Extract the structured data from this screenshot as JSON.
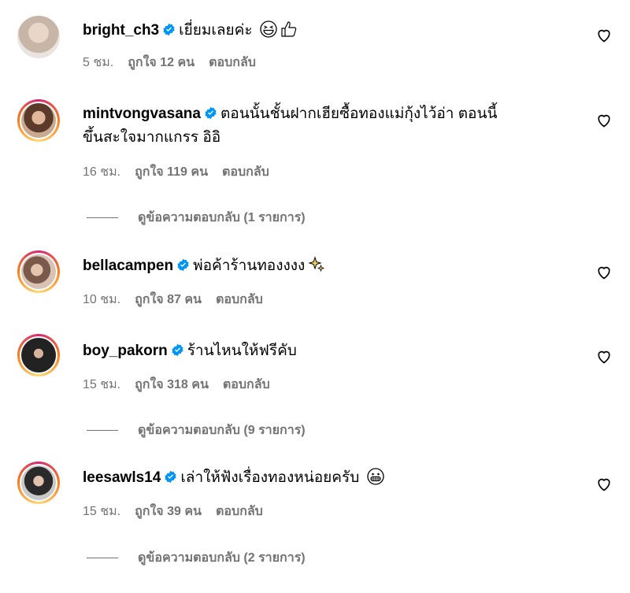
{
  "comments": [
    {
      "username": "bright_ch3",
      "text": "เยี่ยมเลยค่ะ",
      "time": "5 ชม.",
      "likes": "ถูกใจ 12 คน",
      "reply": "ตอบกลับ",
      "story_ring": false
    },
    {
      "username": "mintvongvasana",
      "text": "ตอนนั้นชั้นฝากเฮียซื้อทองแม่กุ้งไว้อ่า ตอนนี้",
      "text_line2": "ขึ้นสะใจมากแกรร อิอิ",
      "time": "16 ชม.",
      "likes": "ถูกใจ 119 คน",
      "reply": "ตอบกลับ",
      "view_replies": "ดูข้อความตอบกลับ (1 รายการ)",
      "story_ring": true
    },
    {
      "username": "bellacampen",
      "text": "พ่อค้าร้านทองงงง",
      "time": "10 ชม.",
      "likes": "ถูกใจ 87 คน",
      "reply": "ตอบกลับ",
      "story_ring": true
    },
    {
      "username": "boy_pakorn",
      "text": "ร้านไหนให้ฟรีคับ",
      "time": "15 ชม.",
      "likes": "ถูกใจ 318 คน",
      "reply": "ตอบกลับ",
      "view_replies": "ดูข้อความตอบกลับ (9 รายการ)",
      "story_ring": true
    },
    {
      "username": "leesawls14",
      "text": "เล่าให้ฟังเรื่องทองหน่อยครับ",
      "time": "15 ชม.",
      "likes": "ถูกใจ 39 คน",
      "reply": "ตอบกลับ",
      "view_replies": "ดูข้อความตอบกลับ (2 รายการ)",
      "story_ring": true
    }
  ],
  "icons": {
    "verified": "verified-badge-icon",
    "heart": "heart-outline-icon"
  },
  "colors": {
    "verified_blue": "#0095f6",
    "meta_gray": "#737373"
  }
}
